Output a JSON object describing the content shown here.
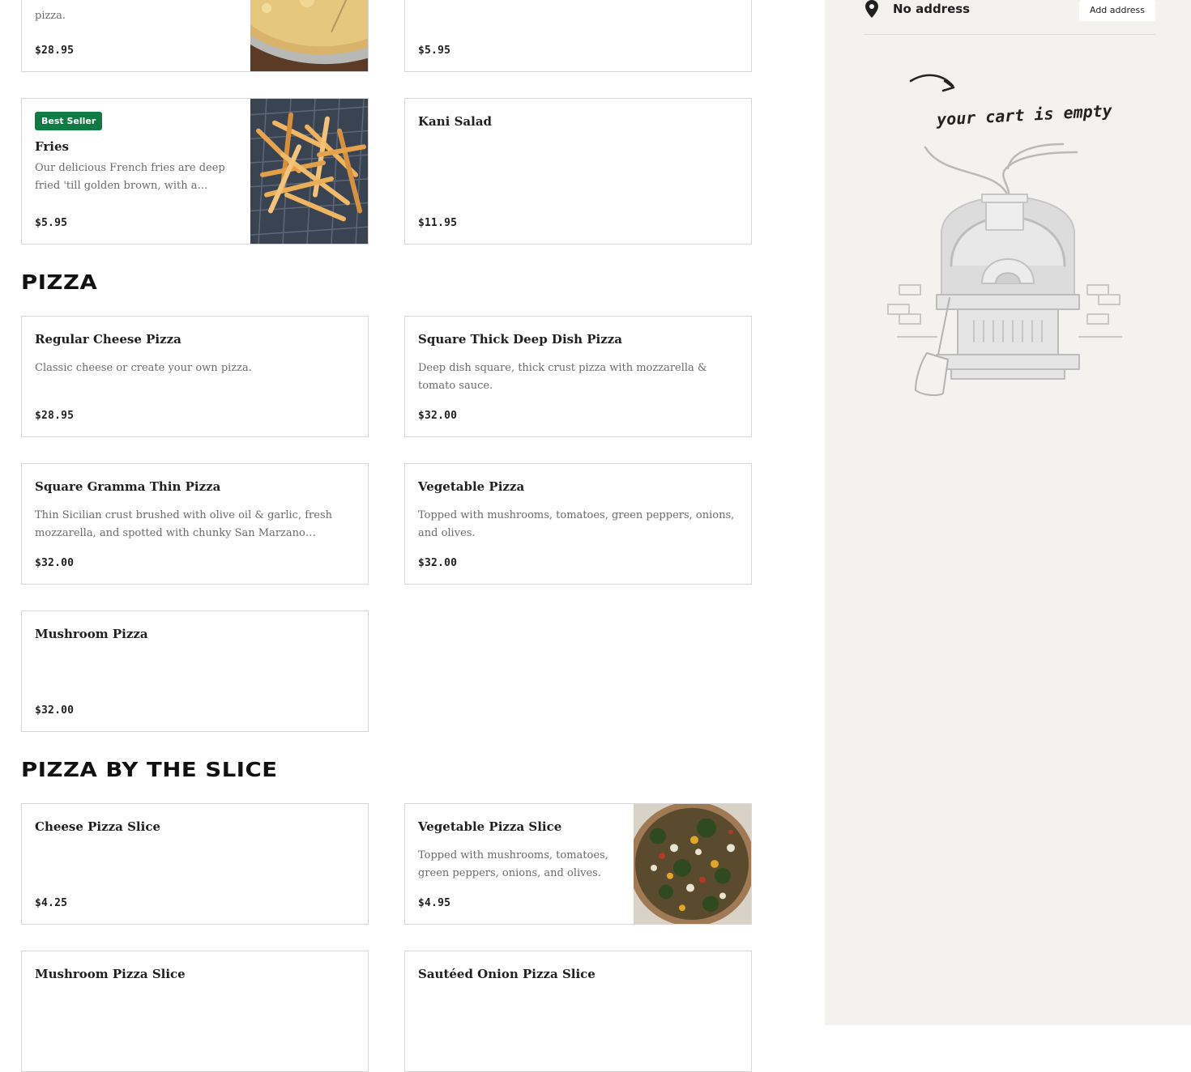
{
  "menu": {
    "sections": [
      {
        "cards": [
          {
            "description": "pizza.",
            "price": "$28.95"
          },
          {
            "price": "$5.95"
          },
          {
            "badge": "Best Seller",
            "name": "Fries",
            "description": "Our delicious French fries are deep fried 'till golden brown, with a crunch...",
            "price": "$5.95"
          },
          {
            "name": "Kani Salad",
            "price": "$11.95"
          }
        ]
      },
      {
        "title": "PIZZA",
        "cards": [
          {
            "name": "Regular Cheese Pizza",
            "description": "Classic cheese or create your own pizza.",
            "price": "$28.95"
          },
          {
            "name": "Square Thick Deep Dish Pizza",
            "description": "Deep dish square, thick crust pizza with mozzarella & tomato sauce.",
            "price": "$32.00"
          },
          {
            "name": "Square Gramma Thin Pizza",
            "description": "Thin Sicilian crust brushed with olive oil & garlic, fresh mozzarella, and spotted with chunky San Marzano tomato...",
            "price": "$32.00"
          },
          {
            "name": "Vegetable Pizza",
            "description": "Topped with mushrooms, tomatoes, green peppers, onions, and olives.",
            "price": "$32.00"
          },
          {
            "name": "Mushroom Pizza",
            "price": "$32.00"
          }
        ]
      },
      {
        "title": "PIZZA BY THE SLICE",
        "cards": [
          {
            "name": "Cheese Pizza Slice",
            "price": "$4.25"
          },
          {
            "name": "Vegetable Pizza Slice",
            "description": "Topped with mushrooms, tomatoes, green peppers, onions, and olives.",
            "price": "$4.95"
          },
          {
            "name": "Mushroom Pizza Slice"
          },
          {
            "name": "Sautéed Onion Pizza Slice"
          }
        ]
      }
    ]
  },
  "cart": {
    "address_label": "No address",
    "add_address_label": "Add address",
    "empty_message": "your cart is empty"
  },
  "colors": {
    "badge_best_seller": "#0e7b45",
    "sidebar_background": "#f3f2ef",
    "card_border": "#d6d6d6"
  },
  "icons": {
    "address": "map-pin-icon",
    "cart_empty": "pizza-oven-illustration"
  }
}
